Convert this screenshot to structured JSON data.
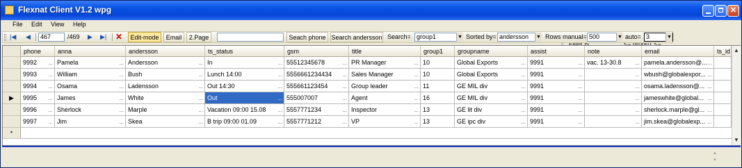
{
  "window": {
    "title": "Flexnat Client V1.2 wpg"
  },
  "menu": [
    {
      "label": "File"
    },
    {
      "label": "Edit"
    },
    {
      "label": "View"
    },
    {
      "label": "Help"
    }
  ],
  "filter": {
    "label": "Filter is",
    "value": "<= group1 <="
  },
  "nav": {
    "current": "467",
    "total": "/469"
  },
  "toolbar": {
    "edit_mode": "Edit-mode",
    "email": "Email",
    "page2": "2.Page",
    "search_box": "",
    "search_phone": "Seach phone",
    "search_name": "Search andersson",
    "search_label": "Search=",
    "search_value": "group1",
    "sorted_label": "Sorted by=",
    "sorted_value": "andersson",
    "rows_label": "Rows manual=",
    "rows_value": "500",
    "auto_label": "auto=",
    "auto_value": "3"
  },
  "grid": {
    "columns": [
      {
        "label": "phone"
      },
      {
        "label": "anna"
      },
      {
        "label": "andersson"
      },
      {
        "label": "ts_status"
      },
      {
        "label": "gsm"
      },
      {
        "label": "title"
      },
      {
        "label": "group1"
      },
      {
        "label": "groupname"
      },
      {
        "label": "assist"
      },
      {
        "label": "note"
      },
      {
        "label": "email"
      },
      {
        "label": "ts_id"
      }
    ],
    "current_row_marker": "▶",
    "new_row_marker": "*",
    "rows": [
      {
        "cells": [
          "9992",
          "Pamela",
          "Andersson",
          "In",
          "55512345678",
          "PR Manager",
          "10",
          "Global Exports",
          "9991",
          "vac. 13-30.8",
          "pamela.andersson@...",
          ""
        ]
      },
      {
        "cells": [
          "9993",
          "William",
          "Bush",
          "Lunch 14:00",
          "5556661234434",
          "Sales Manager",
          "10",
          "Global Exports",
          "9991",
          "",
          "wbush@globalexpor...",
          ""
        ]
      },
      {
        "cells": [
          "9994",
          "Osama",
          "Ladensson",
          "Out 14:30",
          "555661123454",
          "Group leader",
          "11",
          "GE MIL div",
          "9991",
          "",
          "osama.ladensson@...",
          ""
        ]
      },
      {
        "cells": [
          "9995",
          "James",
          "White",
          "Out",
          "555007007",
          "Agent",
          "16",
          "GE MIL div",
          "9991",
          "",
          "jameswhite@global...",
          ""
        ]
      },
      {
        "cells": [
          "9996",
          "Sherlock",
          "Marple",
          "Vacation 09:00 15.08",
          "5557771234",
          "Inspector",
          "13",
          "GE lit div",
          "9991",
          "",
          "sherlock.marple@gl...",
          ""
        ]
      },
      {
        "cells": [
          "9997",
          "Jim",
          "Skea",
          "B trip 09:00 01.09",
          "5557771212",
          "VP",
          "13",
          "GE ipc div",
          "9991",
          "",
          "jim.skea@globalexp...",
          ""
        ]
      }
    ]
  }
}
